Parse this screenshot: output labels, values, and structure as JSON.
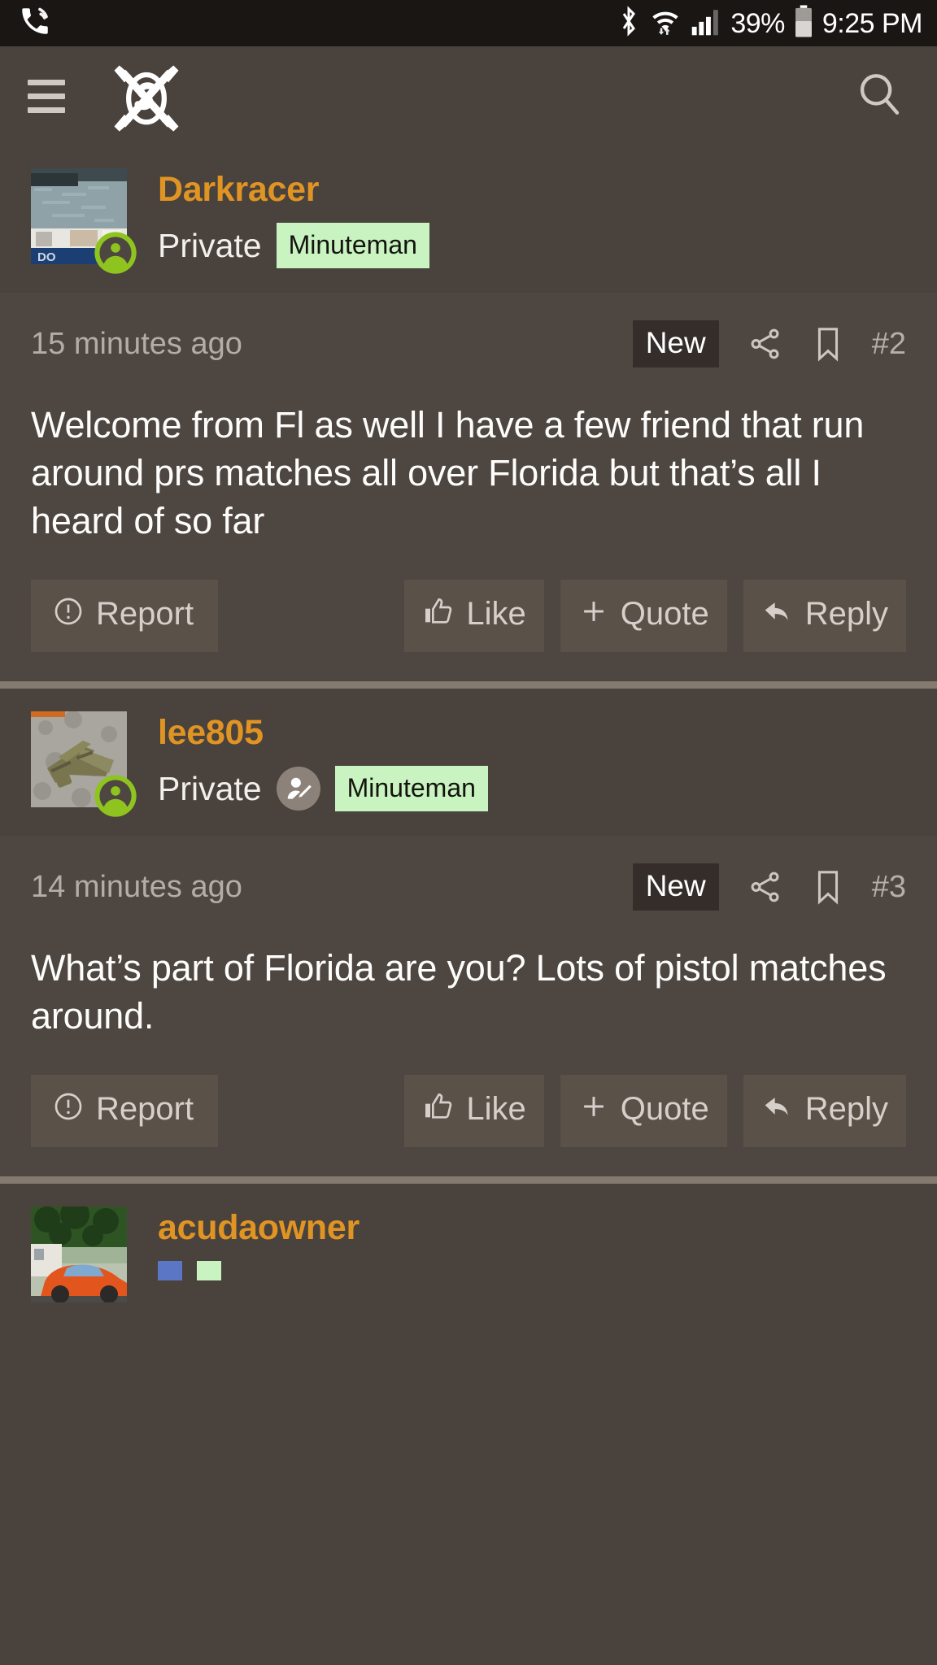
{
  "statusbar": {
    "call_icon": "phone-in-call-icon",
    "bluetooth_icon": "bluetooth-icon",
    "wifi_icon": "wifi-icon",
    "signal_icon": "cell-signal-icon",
    "battery_percent": "39%",
    "battery_icon": "battery-icon",
    "time": "9:25 PM"
  },
  "appbar": {
    "menu_icon": "hamburger-menu-icon",
    "logo_icon": "sniperhide-logo-icon",
    "search_icon": "search-icon"
  },
  "posts": [
    {
      "username": "Darkracer",
      "rank": "Private",
      "title_badge": "Minuteman",
      "has_profile_icon": false,
      "online": true,
      "avatar_alt": "boat-on-water-avatar",
      "timestamp": "15 minutes ago",
      "new_badge": "New",
      "share_icon": "share-icon",
      "bookmark_icon": "bookmark-icon",
      "post_number": "#2",
      "message": "Welcome from Fl as well I have a few friend that run around prs matches all over Florida but that’s all I heard of so far",
      "actions": {
        "report": "Report",
        "like": "Like",
        "quote": "Quote",
        "reply": "Reply",
        "report_icon": "exclamation-circle-icon",
        "like_icon": "thumbs-up-icon",
        "quote_icon": "plus-icon",
        "reply_icon": "reply-arrow-icon"
      }
    },
    {
      "username": "lee805",
      "rank": "Private",
      "title_badge": "Minuteman",
      "has_profile_icon": true,
      "profile_icon": "user-edit-icon",
      "online": true,
      "avatar_alt": "pistol-avatar",
      "timestamp": "14 minutes ago",
      "new_badge": "New",
      "share_icon": "share-icon",
      "bookmark_icon": "bookmark-icon",
      "post_number": "#3",
      "message": "What’s part of Florida are you? Lots of pistol matches around.",
      "actions": {
        "report": "Report",
        "like": "Like",
        "quote": "Quote",
        "reply": "Reply",
        "report_icon": "exclamation-circle-icon",
        "like_icon": "thumbs-up-icon",
        "quote_icon": "plus-icon",
        "reply_icon": "reply-arrow-icon"
      }
    },
    {
      "username": "acudaowner",
      "avatar_alt": "orange-muscle-car-avatar",
      "badge_blue": "",
      "badge_green": ""
    }
  ],
  "colors": {
    "accent_username": "#e09424",
    "badge_green_bg": "#c9f3c1",
    "badge_blue_bg": "#5b76c4",
    "page_bg": "#4a423c",
    "post_bg": "#4e4640",
    "online_green": "#8fc31f"
  }
}
